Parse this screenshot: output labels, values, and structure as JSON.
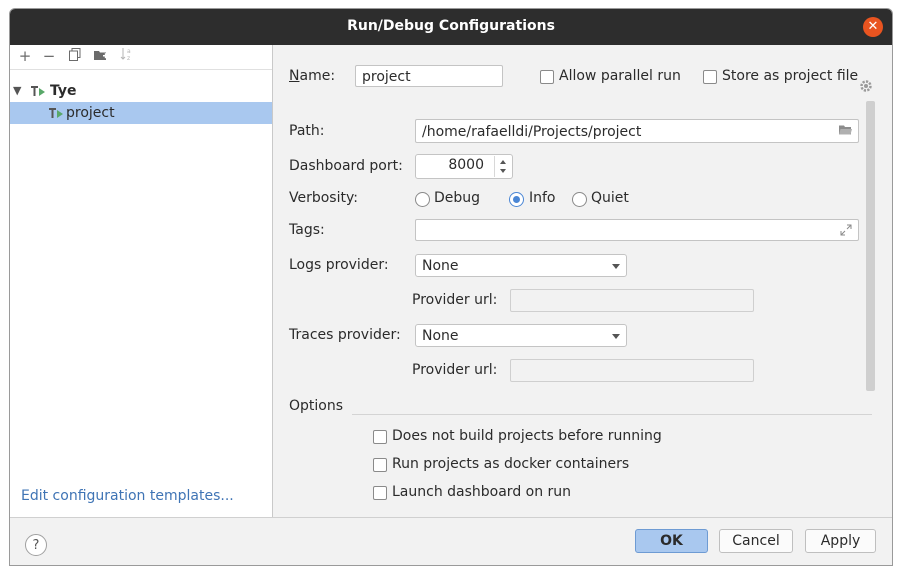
{
  "window": {
    "title": "Run/Debug Configurations"
  },
  "sidebar": {
    "tree": [
      {
        "label": "Tye",
        "expanded": true
      },
      {
        "label": "project",
        "selected": true
      }
    ],
    "edit_templates": "Edit configuration templates..."
  },
  "form": {
    "name_label": "Name:",
    "name_value": "project",
    "allow_parallel_label": "Allow parallel run",
    "store_file_label": "Store as project file",
    "path_label": "Path:",
    "path_value": "/home/rafaelldi/Projects/project",
    "port_label": "Dashboard port:",
    "port_value": "8000",
    "verbosity_label": "Verbosity:",
    "verbosity_options": [
      "Debug",
      "Info",
      "Quiet"
    ],
    "verbosity_selected": "Info",
    "tags_label": "Tags:",
    "tags_value": "",
    "logs_provider_label": "Logs provider:",
    "logs_provider_value": "None",
    "provider_url_label": "Provider url:",
    "traces_provider_label": "Traces provider:",
    "traces_provider_value": "None",
    "options_label": "Options",
    "options": [
      "Does not build projects before running",
      "Run projects as docker containers",
      "Launch dashboard on run"
    ]
  },
  "buttons": {
    "help": "?",
    "ok": "OK",
    "cancel": "Cancel",
    "apply": "Apply"
  },
  "colors": {
    "titlebar": "#2d2d2d",
    "close": "#e95420",
    "selection": "#a9c8ef",
    "accent": "#4a86d5",
    "link": "#3f74b5"
  }
}
